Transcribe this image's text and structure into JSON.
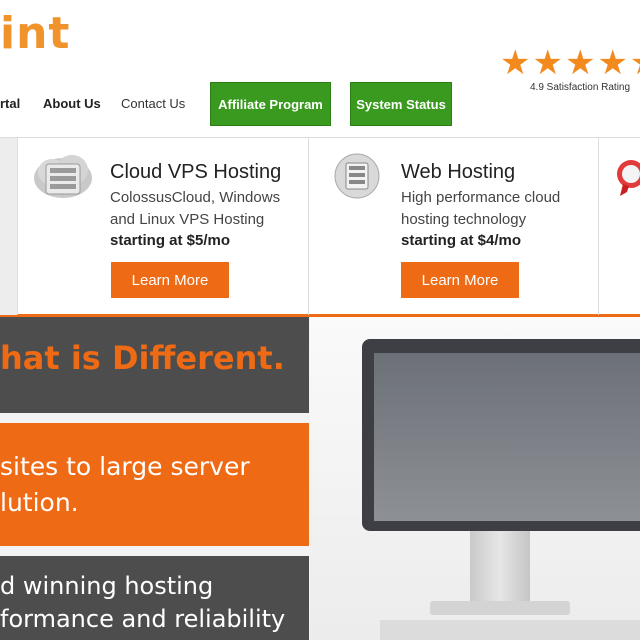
{
  "header": {
    "logo_text": "int",
    "stars": "★★★★★",
    "rating_text": "4.9 Satisfaction Rating"
  },
  "nav": {
    "partial_link": "rtal",
    "about": "About Us",
    "contact": "Contact Us",
    "affiliate": "Affiliate Program",
    "status": "System Status"
  },
  "products": [
    {
      "title": "Cloud VPS Hosting",
      "desc": "ColossusCloud, Windows and Linux VPS Hosting",
      "price": "starting at $5/mo",
      "button": "Learn More"
    },
    {
      "title": "Web Hosting",
      "desc": "High performance cloud hosting technology",
      "price": "starting at $4/mo",
      "button": "Learn More"
    }
  ],
  "hero": {
    "line1": "hat is Different.",
    "line2a": "sites to large server",
    "line2b": "lution.",
    "line3a": "d winning hosting",
    "line3b": "formance and reliability"
  },
  "colors": {
    "accent": "#ee6a14",
    "nav_button": "#3a9a1f",
    "dark": "#4d4d4d"
  }
}
